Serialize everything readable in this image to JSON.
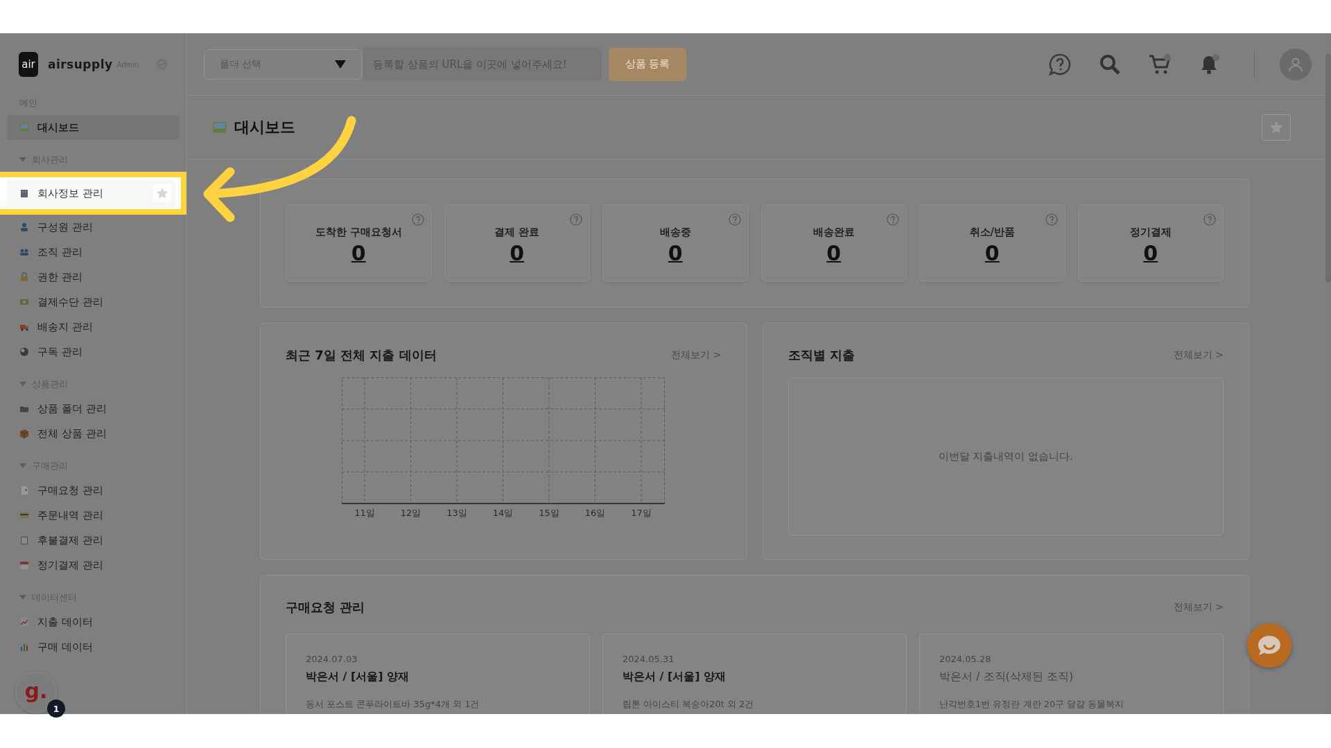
{
  "brand": {
    "logo": "air",
    "name": "airsupply",
    "badge": "Admin"
  },
  "sidebar": {
    "sections": [
      {
        "title": "메인",
        "items": [
          {
            "label": "대시보드",
            "selected": true,
            "highlighted": false
          }
        ]
      },
      {
        "title": "회사관리",
        "expanded": true,
        "items": [
          {
            "label": "회사정보 관리",
            "selected": false,
            "highlighted": true,
            "starred": false
          },
          {
            "label": "구성원 관리",
            "selected": false,
            "highlighted": false
          },
          {
            "label": "조직 관리",
            "selected": false,
            "highlighted": false
          },
          {
            "label": "권한 관리",
            "selected": false,
            "highlighted": false
          },
          {
            "label": "결제수단 관리",
            "selected": false,
            "highlighted": false
          },
          {
            "label": "배송지 관리",
            "selected": false,
            "highlighted": false
          },
          {
            "label": "구독 관리",
            "selected": false,
            "highlighted": false
          }
        ]
      },
      {
        "title": "상품관리",
        "expanded": true,
        "items": [
          {
            "label": "상품 폴더 관리",
            "selected": false,
            "highlighted": false
          },
          {
            "label": "전체 상품 관리",
            "selected": false,
            "highlighted": false
          }
        ]
      },
      {
        "title": "구매관리",
        "expanded": true,
        "items": [
          {
            "label": "구매요청 관리",
            "selected": false,
            "highlighted": false
          },
          {
            "label": "주문내역 관리",
            "selected": false,
            "highlighted": false
          },
          {
            "label": "후불결제 관리",
            "selected": false,
            "highlighted": false
          },
          {
            "label": "정기결제 관리",
            "selected": false,
            "highlighted": false
          }
        ]
      },
      {
        "title": "데이터센터",
        "expanded": true,
        "items": [
          {
            "label": "지출 데이터",
            "selected": false,
            "highlighted": false
          },
          {
            "label": "구매 데이터",
            "selected": false,
            "highlighted": false
          }
        ]
      }
    ]
  },
  "topbar": {
    "folder_select": {
      "placeholder": "폴더 선택"
    },
    "url_field": {
      "placeholder": "등록할 상품의 URL을 이곳에 넣어주세요!"
    },
    "register_button": "상품 등록",
    "cart_dot": true,
    "bell_dot": true
  },
  "page": {
    "title": "대시보드",
    "favorite": false
  },
  "stats": [
    {
      "label": "도착한 구매요청서",
      "value": "0"
    },
    {
      "label": "결제 완료",
      "value": "0"
    },
    {
      "label": "배송중",
      "value": "0"
    },
    {
      "label": "배송완료",
      "value": "0"
    },
    {
      "label": "취소/반품",
      "value": "0"
    },
    {
      "label": "정기결제",
      "value": "0"
    }
  ],
  "spend_panel": {
    "title": "최근 7일 전체 지출 데이터",
    "link": "전체보기 >",
    "x_labels": [
      "11일",
      "12일",
      "13일",
      "14일",
      "15일",
      "16일",
      "17일"
    ]
  },
  "org_panel": {
    "title": "조직별 지출",
    "link": "전체보기 >",
    "empty_message": "이번달 지출내역이 없습니다."
  },
  "requests_panel": {
    "title": "구매요청 관리",
    "link": "전체보기 >",
    "cards": [
      {
        "date": "2024.07.03",
        "title": "박은서 / [서울] 양재",
        "muted": false,
        "summary": "동서 포스트 콘푸라이트바 35g*4개 외 1건"
      },
      {
        "date": "2024.05.31",
        "title": "박은서 / [서울] 양재",
        "muted": false,
        "summary": "립톤 아이스티 복숭아20t 외 2건"
      },
      {
        "date": "2024.05.28",
        "title": "박은서 / 조직(삭제된 조직)",
        "muted": true,
        "summary": "난각번호1번 유정란 계란 20구 달걀 동물복지"
      }
    ]
  },
  "chat_badge": {
    "letter": "g.",
    "count": "1"
  }
}
